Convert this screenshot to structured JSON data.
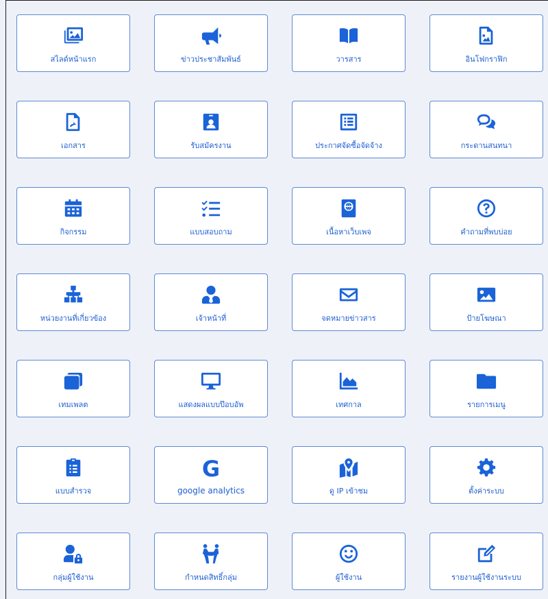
{
  "colors": {
    "accent": "#1a63d8",
    "border": "#5f87d6",
    "background": "#eef2f8",
    "tile": "#ffffff"
  },
  "tiles": [
    {
      "label": "สไลด์หน้าแรก",
      "icon": "images-icon"
    },
    {
      "label": "ข่าวประชาสัมพันธ์",
      "icon": "megaphone-icon"
    },
    {
      "label": "วารสาร",
      "icon": "book-open-icon"
    },
    {
      "label": "อินโฟกราฟิก",
      "icon": "file-image-icon"
    },
    {
      "label": "เอกสาร",
      "icon": "file-pdf-icon"
    },
    {
      "label": "รับสมัครงาน",
      "icon": "id-badge-icon"
    },
    {
      "label": "ประกาศจัดซื้อจัดจ้าง",
      "icon": "list-alt-icon"
    },
    {
      "label": "กระดานสนทนา",
      "icon": "comments-icon"
    },
    {
      "label": "กิจกรรม",
      "icon": "calendar-icon"
    },
    {
      "label": "แบบสอบถาม",
      "icon": "tasks-icon"
    },
    {
      "label": "เนื้อหาเว็บเพจ",
      "icon": "globe-passport-icon"
    },
    {
      "label": "คำถามที่พบบ่อย",
      "icon": "question-circle-icon"
    },
    {
      "label": "หน่วยงานที่เกี่ยวข้อง",
      "icon": "sitemap-icon"
    },
    {
      "label": "เจ้าหน้าที่",
      "icon": "user-tie-icon"
    },
    {
      "label": "จดหมายข่าวสาร",
      "icon": "envelope-icon"
    },
    {
      "label": "ป้ายโฆษณา",
      "icon": "image-icon"
    },
    {
      "label": "เทมเพลต",
      "icon": "window-restore-icon"
    },
    {
      "label": "แสดงผลแบบป๊อบอัพ",
      "icon": "desktop-icon"
    },
    {
      "label": "เทศกาล",
      "icon": "chart-area-icon"
    },
    {
      "label": "รายการเมนู",
      "icon": "folder-icon"
    },
    {
      "label": "แบบสำรวจ",
      "icon": "clipboard-list-icon"
    },
    {
      "label": "google analytics",
      "icon": "google-icon",
      "glyph": "G"
    },
    {
      "label": "ดู IP เข้าชม",
      "icon": "map-marked-icon"
    },
    {
      "label": "ตั้งค่าระบบ",
      "icon": "cog-icon"
    },
    {
      "label": "กลุ่มผู้ใช้งาน",
      "icon": "user-lock-icon"
    },
    {
      "label": "กำหนดสิทธิ์กลุ่ม",
      "icon": "people-carry-icon"
    },
    {
      "label": "ผู้ใช้งาน",
      "icon": "smile-icon"
    },
    {
      "label": "รายงานผู้ใช้งานระบบ",
      "icon": "edit-icon"
    }
  ]
}
